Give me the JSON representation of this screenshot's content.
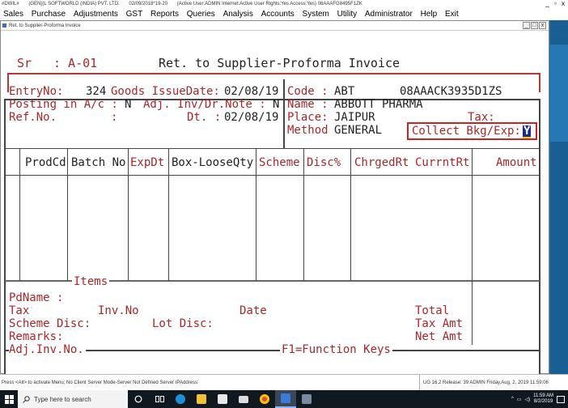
{
  "app": {
    "title_parts": [
      "#DWIL#",
      "(GEN)(L SOFTWORLD (INDIA) PVT. LTD.",
      "02/09/2018*19-20",
      "(Active User:ADMIN Internet:Active User Rights:Yes Access:Yes) 08AAAFG8495F1ZK"
    ],
    "window_controls": "_ ▫ x"
  },
  "menu": [
    "Sales",
    "Purchase",
    "Adjustments",
    "GST",
    "Reports",
    "Queries",
    "Analysis",
    "Accounts",
    "System",
    "Utility",
    "Administrator",
    "Help",
    "Exit"
  ],
  "child_window": {
    "title": "Ret. to Supplier-Proforma Invoice",
    "controls": [
      "_",
      "□",
      "x"
    ]
  },
  "header": {
    "sr_label": "Sr",
    "sr_value": ": A-01",
    "doc_title": "Ret. to Supplier-Proforma Invoice"
  },
  "form": {
    "entry_no_label": "EntryNo:",
    "entry_no": "324",
    "goods_issue_label": "Goods IssueDate:",
    "goods_issue_date": "02/08/19",
    "posting_label": "Posting in A/c :",
    "posting_value": "N",
    "adj_label": "Adj. Inv/Dr.Note :",
    "adj_value": "N",
    "ref_label": "Ref.No.",
    "ref_colon": ":",
    "dt_label": "Dt. :",
    "dt_value": "02/08/19",
    "code_label": "Code :",
    "code_value": "ABT",
    "gstin": "08AAACK3935D1ZS",
    "name_label": "Name :",
    "name_value": "ABBOTT PHARMA",
    "place_label": "Place:",
    "place_value": "JAIPUR",
    "tax_label": "Tax:",
    "method_label": "Method",
    "method_value": "GENERAL",
    "collect_label": "Collect Bkg/Exp:",
    "collect_value": "Y"
  },
  "table": {
    "columns": [
      "ProdCd",
      "Batch No",
      "ExpDt",
      "Box-LooseQty",
      "Scheme",
      "Disc%",
      "ChrgedRt",
      "CurrntRt",
      "Amount"
    ],
    "items_label": "Items"
  },
  "footer": {
    "pdname": "PdName :",
    "tax": "Tax",
    "inv_no": "Inv.No",
    "date": "Date",
    "total": "Total",
    "scheme_disc": "Scheme Disc:",
    "lot_disc": "Lot Disc:",
    "tax_amt": "Tax Amt",
    "remarks": "Remarks:",
    "net_amt": "Net Amt",
    "adj_inv_no": "Adj.Inv.No.",
    "function_keys": "F1=Function Keys"
  },
  "status": {
    "left": "Press <Alt> to activate Menu; No Client Server Mode-Server Not Defined Server IPAddress:",
    "right": "UG 16.2 Release: 39 ADMIN Friday,Aug. 2, 2019 11:59:06"
  },
  "taskbar": {
    "search_placeholder": "Type here to search",
    "time": "11:59 AM",
    "date": "8/2/2019"
  },
  "colors": {
    "field_text": "#a8272a",
    "highlight_border": "#d02020",
    "cursor_bg": "#1a2a8a",
    "desktop": "#1c6fa6"
  }
}
